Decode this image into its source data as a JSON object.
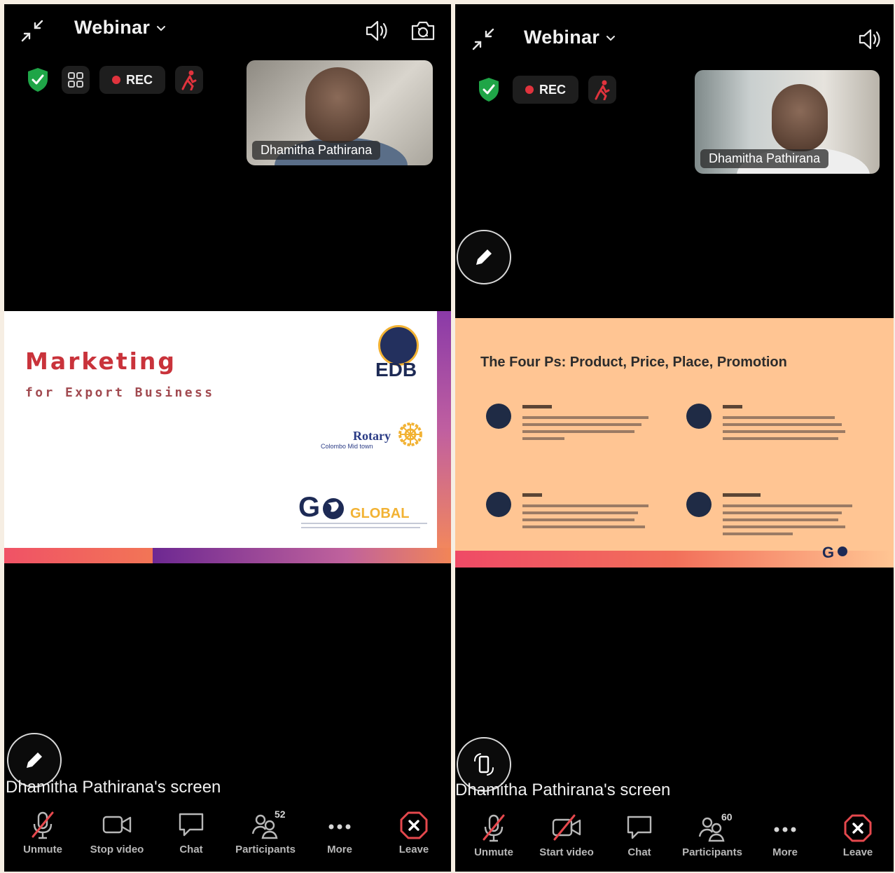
{
  "left": {
    "title": "Webinar",
    "rec_label": "REC",
    "participant_video": {
      "name": "Dhamitha Pathirana"
    },
    "slide": {
      "title": "Marketing",
      "subtitle": "for Export Business",
      "logo_edb": "EDB",
      "logo_rotary": "Rotary",
      "logo_rotary_sub": "Colombo Mid town",
      "logo_go_g": "G",
      "logo_go_global": "GLOBAL"
    },
    "screen_label": "Dhamitha Pathirana's screen",
    "toolbar": {
      "unmute": "Unmute",
      "video": "Stop video",
      "chat": "Chat",
      "participants": "Participants",
      "participants_count": "52",
      "more": "More",
      "leave": "Leave"
    }
  },
  "right": {
    "title": "Webinar",
    "rec_label": "REC",
    "participant_video": {
      "name": "Dhamitha Pathirana"
    },
    "slide": {
      "title": "The Four Ps: Product, Price, Place, Promotion",
      "logo_go_g": "G"
    },
    "screen_label": "Dhamitha Pathirana's screen",
    "toolbar": {
      "unmute": "Unmute",
      "video": "Start video",
      "chat": "Chat",
      "participants": "Participants",
      "participants_count": "60",
      "more": "More",
      "leave": "Leave"
    }
  },
  "colors": {
    "background": "#000000",
    "frame": "#f6eee3",
    "shield": "#1fa547",
    "rec": "#e0333d",
    "leave": "#e5484d",
    "slide_left_bg": "#ffffff",
    "slide_right_bg": "#ffc593",
    "marketing_red": "#c9333b",
    "purple_accent": "#7d2f9e",
    "orange_accent": "#f26e3c"
  }
}
